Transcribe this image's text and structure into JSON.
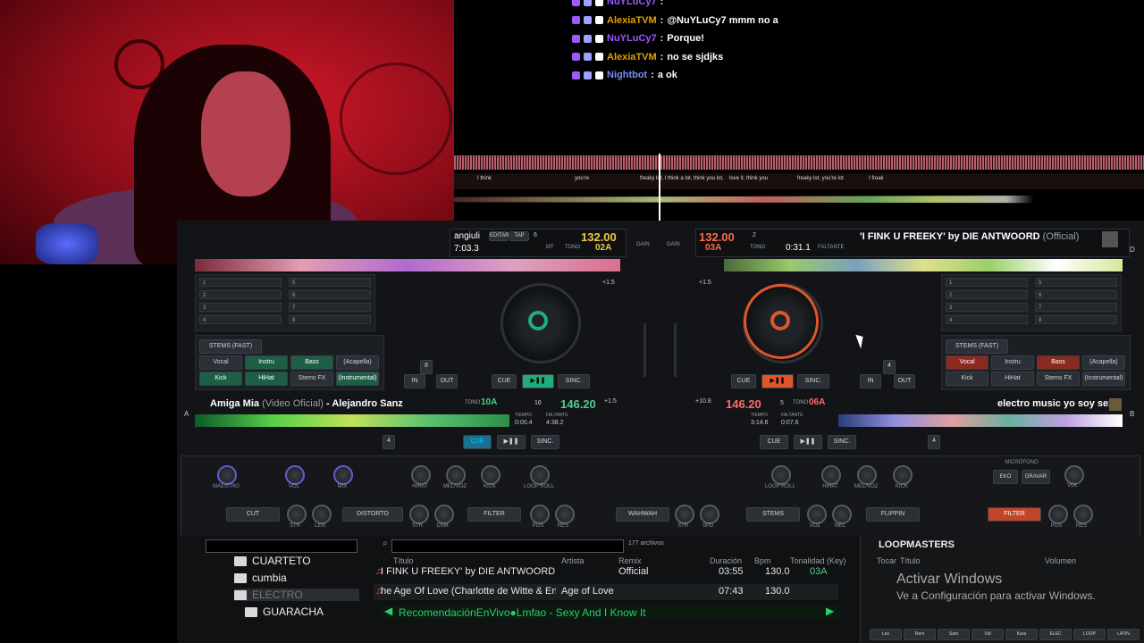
{
  "chat": {
    "lines": [
      {
        "user": "NuYLuCy7",
        "sep": ":",
        "msg": "",
        "color": "#9b59ff"
      },
      {
        "user": "AlexiaTVM",
        "sep": ":",
        "msg": "@NuYLuCy7 mmm no a",
        "color": "#e0a100"
      },
      {
        "user": "NuYLuCy7",
        "sep": ":",
        "msg": "Porque!",
        "color": "#9b59ff"
      },
      {
        "user": "AlexiaTVM",
        "sep": ":",
        "msg": "no se sjdjks",
        "color": "#e0a100"
      },
      {
        "user": "Nightbot",
        "sep": ":",
        "msg": "a ok",
        "color": "#7a8cff"
      }
    ]
  },
  "overview": {
    "lyrics": [
      "I think",
      "you're",
      "freaky lot, I think a lot, think you lot,",
      "love it, think you",
      "freaky lot, you're lot",
      "I freak"
    ]
  },
  "deck_top_left": {
    "title_partial": "angiuli",
    "time": "7:03.3",
    "bpm": "132.00",
    "key": "02A",
    "key_label": "TONO",
    "pitch_label": "MT",
    "edit_label": "EDITAR",
    "tap_label": "TAP",
    "keylock": "6",
    "cue_label": "CUE",
    "sync_label": "SINC.",
    "in_label": "IN",
    "out_label": "OUT",
    "loop_size": "8",
    "pitch_range": "+1.5",
    "stems_title": "STEMS (FAST)",
    "stems": [
      "Vocal",
      "Instru",
      "Bass",
      "(Acapella)",
      "Kick",
      "HiHat",
      "Stems FX",
      "(Instrumental)"
    ],
    "hotcues": [
      "1",
      "2",
      "3",
      "4",
      "5",
      "6",
      "7",
      "8"
    ]
  },
  "deck_top_right": {
    "title": "'I FINK U FREEKY' by DIE ANTWOORD",
    "title_suffix": "(Official)",
    "bpm": "132.00",
    "key": "03A",
    "key_label": "TONO",
    "elapsed": "0:31.1",
    "remaining_label": "FALTANTE",
    "keylock": "2",
    "cue_label": "CUE",
    "sync_label": "SINC.",
    "in_label": "IN",
    "out_label": "OUT",
    "loop_size": "4",
    "pitch_range": "+1.5",
    "stems_title": "STEMS (FAST)",
    "stems": [
      "Vocal",
      "Instru",
      "Bass",
      "(Acapella)",
      "Kick",
      "HiHat",
      "Stems FX",
      "(Instrumental)"
    ],
    "hotcues": [
      "1",
      "2",
      "3",
      "4",
      "5",
      "6",
      "7",
      "8"
    ],
    "side": "D"
  },
  "deck_mid_left": {
    "side": "A",
    "title": "Amiga Mia",
    "title_gray": "(Video Oficial)",
    "artist": "- Alejandro Sanz",
    "key": "10A",
    "key_label": "TONO",
    "keylock": "16",
    "bpm": "146.20",
    "time_label": "TIEMPO",
    "time": "0:00.4",
    "remain_label": "FALTANTE",
    "remain": "4:38.2",
    "pitch_range": "+1.5",
    "loop_size": "4",
    "cue_label": "CUE",
    "sync_label": "SINC."
  },
  "deck_mid_right": {
    "side": "B",
    "title": "electro music yo soy sexy",
    "bpm": "146.20",
    "keylock": "5",
    "key": "06A",
    "key_label": "TONO",
    "time_label": "TIEMPO",
    "time": "3:14.6",
    "remain_label": "FALTANTE",
    "remain": "0:07.6",
    "pitch_range": "+10.8",
    "loop_size": "4",
    "cue_label": "CUE",
    "sync_label": "SINC."
  },
  "mixer": {
    "gain_label": "GAIN",
    "left_knobs": [
      "MAESTRO",
      "VOL",
      "MIX"
    ],
    "eq_left": [
      "HIHAT",
      "MEL/VOZ",
      "KICK",
      "LOOP ROLL"
    ],
    "eq_right": [
      "LOOP ROLL",
      "HIHAT",
      "MEL/VOZ",
      "KICK"
    ],
    "mic_label": "MICRÓFONO",
    "mic_buttons": [
      "EKO",
      "GRAVAR"
    ],
    "mic_vol": "VOL"
  },
  "effects": {
    "cut": "CUT",
    "str": "STR",
    "len": "LEN",
    "distorto": "DISTORTO",
    "dsm": "DSM",
    "filter": "FILTER",
    "pos": "POS",
    "res": "RES",
    "wahwah": "WAHWAH",
    "spd": "SPD",
    "stems": "STEMS",
    "voz": "VOZ",
    "mel": "MEL",
    "flippin": "FLIPPIN",
    "filter2": "FILTER"
  },
  "browser": {
    "file_count": "177 archivos",
    "folders": [
      "CUARTETO",
      "cumbia",
      "ELECTRO",
      "GUARACHA"
    ],
    "columns": [
      "Título",
      "Artista",
      "Remix",
      "Duración",
      "Bpm",
      "Tonalidad (Key)"
    ],
    "rows": [
      {
        "title": "I FINK U FREEKY' by DIE ANTWOORD",
        "artist": "",
        "remix": "Official",
        "duration": "03:55",
        "bpm": "130.0",
        "key": "03A"
      },
      {
        "title": "he Age Of Love (Charlotte de Witte & Enrico San",
        "artist": "Age of Love",
        "remix": "",
        "duration": "07:43",
        "bpm": "130.0",
        "key": ""
      }
    ],
    "now_playing": "RecomendaciónEnVivo●Lmfao - Sexy And I Know It",
    "side_panel_title": "LOOPMASTERS",
    "side_cols": [
      "Tocar",
      "Título",
      "Volumen"
    ],
    "bottom_tabs": [
      "Loo",
      "Rem",
      "Sam",
      "Vid",
      "Kara",
      "ELEC",
      "LOOP",
      "LATIN"
    ]
  },
  "windows_activation": {
    "title": "Activar Windows",
    "subtitle": "Ve a Configuración para activar Windows."
  }
}
